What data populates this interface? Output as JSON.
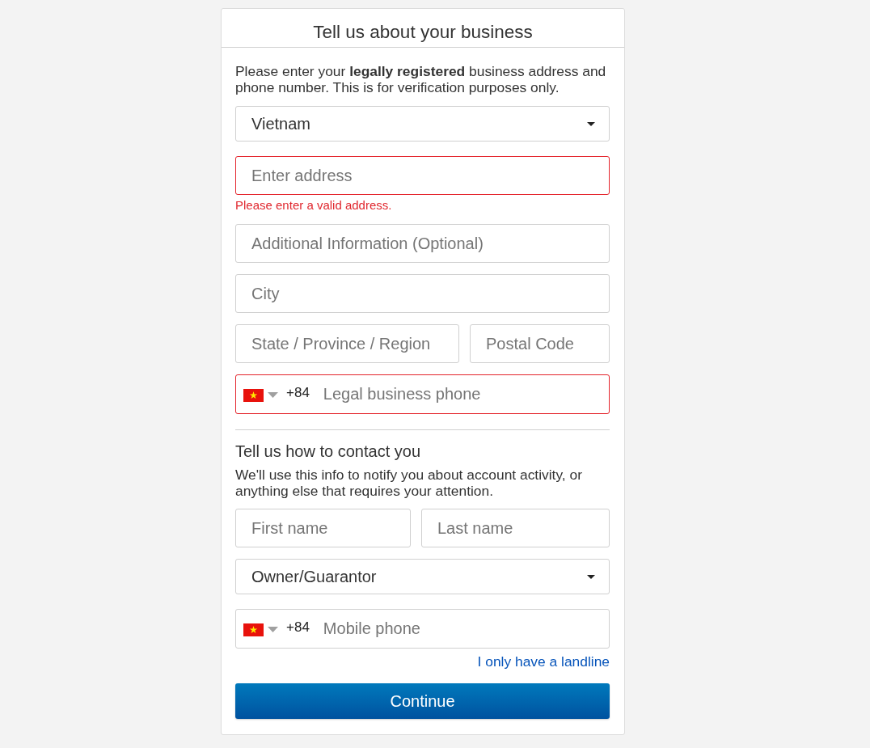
{
  "card": {
    "title": "Tell us about your business"
  },
  "business": {
    "intro": "Please enter your **legally registered** business address and phone number. This is for verification purposes only.",
    "fields": [
      {
        "kind": "select",
        "value": "Vietnam"
      },
      {
        "kind": "input",
        "placeholder": "Enter address",
        "invalid": true,
        "error": "Please enter a valid address."
      },
      {
        "kind": "input",
        "placeholder": "Additional Information (Optional)",
        "invalid": false
      },
      {
        "kind": "input",
        "placeholder": "City",
        "invalid": false
      },
      {
        "kind": "pair",
        "fields": [
          {
            "placeholder": "State / Province / Region",
            "invalid": false
          },
          {
            "placeholder": "Postal Code",
            "invalid": false
          }
        ]
      },
      {
        "kind": "phone",
        "dial_code": "+84",
        "placeholder": "Legal business phone",
        "invalid": true
      }
    ]
  },
  "contact": {
    "heading": "Tell us how to contact you",
    "intro": "We'll use this info to notify you about account activity, or anything else that requires your attention.",
    "fields": [
      {
        "kind": "pair",
        "fields": [
          {
            "placeholder": "First name",
            "invalid": false
          },
          {
            "placeholder": "Last name",
            "invalid": false
          }
        ]
      },
      {
        "kind": "select",
        "value": "Owner/Guarantor"
      },
      {
        "kind": "phone",
        "dial_code": "+84",
        "placeholder": "Mobile phone",
        "invalid": false
      }
    ],
    "link": "I only have a landline"
  },
  "continue_button": "Continue"
}
